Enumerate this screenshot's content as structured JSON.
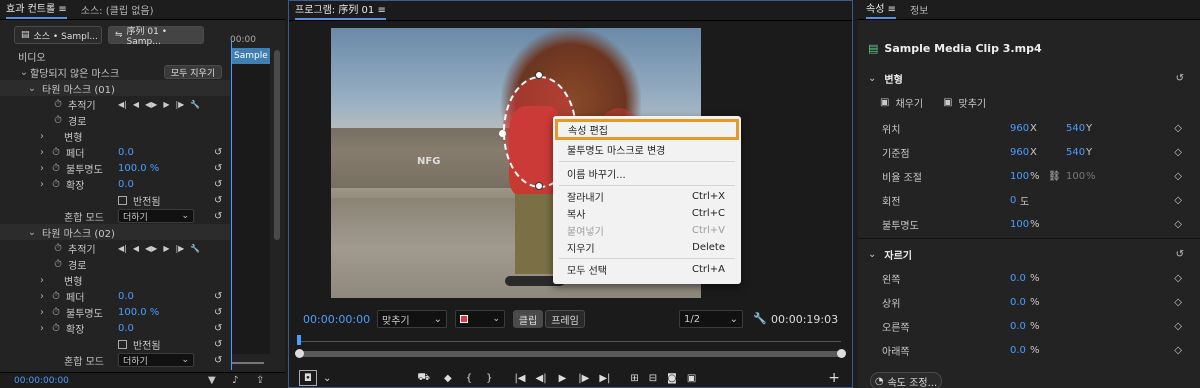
{
  "left_panel": {
    "tabs": [
      "효과 컨트롤",
      "소스: (클립 없음)"
    ],
    "sub_tabs": [
      "소스 • Sampl...",
      "序列 01 • Samp..."
    ],
    "timecode_top": "00:00",
    "clip_label": "Sample",
    "section_video": "비디오",
    "unassigned_mask": "할당되지 않은 마스크",
    "clear_all_button": "모두 지우기",
    "mask1": {
      "title": "타원 마스크 (01)",
      "tracker": "추적기",
      "path": "경로",
      "transform": "변형",
      "feather": "페더",
      "feather_value": "0.0",
      "opacity": "불투명도",
      "opacity_value": "100.0 %",
      "expand": "확장",
      "expand_value": "0.0",
      "invert": "반전됨",
      "blend_mode": "혼합 모드",
      "blend_value": "더하기"
    },
    "mask2": {
      "title": "타원 마스크 (02)",
      "tracker": "추적기",
      "path": "경로",
      "transform": "변형",
      "feather": "페더",
      "feather_value": "0.0",
      "opacity": "불투명도",
      "opacity_value": "100.0 %",
      "expand": "확장",
      "expand_value": "0.0",
      "invert": "반전됨",
      "blend_mode": "혼합 모드",
      "blend_value": "더하기"
    },
    "timecode_bottom": "00:00:00:00"
  },
  "program_monitor": {
    "title": "프로그램: 序列 01",
    "timecode_current": "00:00:00:00",
    "fit_dropdown": "맞추기",
    "clip_button": "클립",
    "frame_button": "프레임",
    "resolution": "1/2",
    "timecode_duration": "00:00:19:03"
  },
  "context_menu": {
    "items": [
      {
        "label": "속성 편집",
        "shortcut": "",
        "highlighted": true,
        "disabled": false
      },
      {
        "label": "불투명도 마스크로 변경",
        "shortcut": "",
        "disabled": false
      },
      {
        "sep": true
      },
      {
        "label": "이름 바꾸기...",
        "shortcut": "",
        "disabled": false
      },
      {
        "sep": true
      },
      {
        "label": "잘라내기",
        "shortcut": "Ctrl+X",
        "disabled": false
      },
      {
        "label": "복사",
        "shortcut": "Ctrl+C",
        "disabled": false
      },
      {
        "label": "붙여넣기",
        "shortcut": "Ctrl+V",
        "disabled": true
      },
      {
        "label": "지우기",
        "shortcut": "Delete",
        "disabled": false
      },
      {
        "sep": true
      },
      {
        "label": "모두 선택",
        "shortcut": "Ctrl+A",
        "disabled": false
      }
    ]
  },
  "right_panel": {
    "tabs": [
      "속성",
      "정보"
    ],
    "clip_name": "Sample Media Clip 3.mp4",
    "transform_section": "변형",
    "fill_label": "채우기",
    "fit_label": "맞추기",
    "position": {
      "label": "위치",
      "x": "960",
      "xu": "X",
      "y": "540",
      "yu": "Y"
    },
    "anchor": {
      "label": "기준점",
      "x": "960",
      "xu": "X",
      "y": "540",
      "yu": "Y"
    },
    "scale": {
      "label": "비율 조절",
      "v1": "100",
      "u1": "%",
      "v2": "100",
      "u2": "%"
    },
    "rotation": {
      "label": "회전",
      "v": "0",
      "u": "도"
    },
    "opacity": {
      "label": "불투명도",
      "v": "100",
      "u": "%"
    },
    "crop_section": "자르기",
    "crop_left": {
      "label": "왼쪽",
      "v": "0.0",
      "u": "%"
    },
    "crop_top": {
      "label": "상위",
      "v": "0.0",
      "u": "%"
    },
    "crop_right": {
      "label": "오른쪽",
      "v": "0.0",
      "u": "%"
    },
    "crop_bottom": {
      "label": "아래쪽",
      "v": "0.0",
      "u": "%"
    },
    "speed_button": "속도 조정..."
  },
  "colors": {
    "accent_blue": "#4c9cff",
    "highlight_orange": "#e39a2b",
    "mask_red": "#cf3b3b"
  }
}
